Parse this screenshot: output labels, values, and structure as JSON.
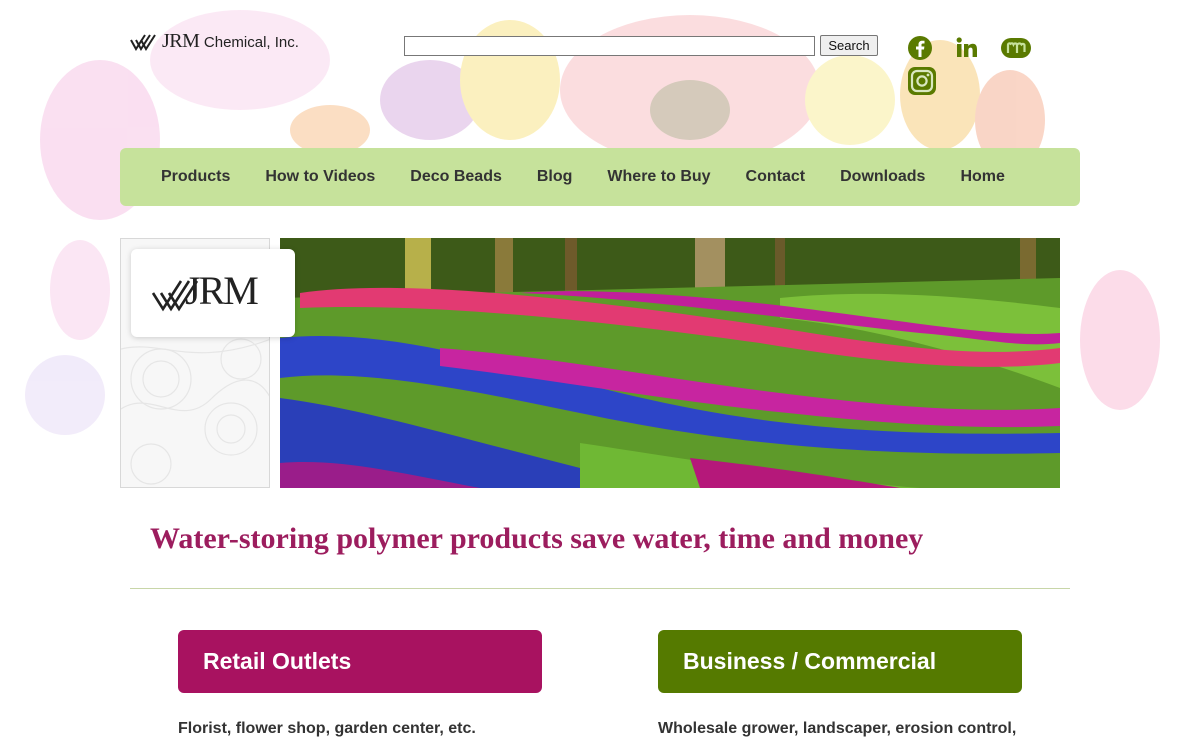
{
  "header": {
    "logo_text": "JRM",
    "logo_company": "Chemical, Inc.",
    "search_value": "",
    "search_button": "Search"
  },
  "social_icons": [
    "facebook-icon",
    "linkedin-icon",
    "meetup-icon",
    "instagram-icon"
  ],
  "nav": [
    "Products",
    "How to Videos",
    "Deco Beads",
    "Blog",
    "Where to Buy",
    "Contact",
    "Downloads",
    "Home"
  ],
  "side_card": {
    "logo_text": "JRM"
  },
  "hero": {
    "icon": "tulip-garden-photo"
  },
  "tagline": "Water-storing polymer products save water, time and money",
  "sections": [
    {
      "title": "Retail Outlets",
      "description": "Florist, flower shop, garden center, etc."
    },
    {
      "title": "Business / Commercial",
      "description": "Wholesale grower, landscaper, erosion control,"
    }
  ],
  "colors": {
    "nav_bg": "#c6e29b",
    "tagline": "#9c1d5e",
    "retail": "#a81260",
    "business": "#557a00",
    "social": "#5a7a00"
  }
}
